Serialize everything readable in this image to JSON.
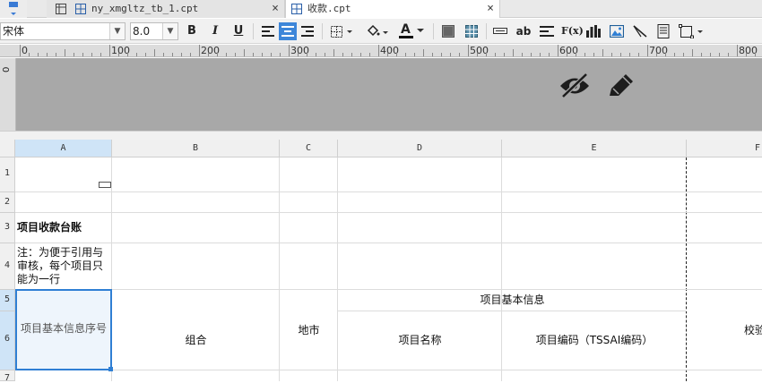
{
  "tabs": [
    {
      "label": "ny_xmgltz_tb_1.cpt",
      "close": "×",
      "active": false
    },
    {
      "label": "收款.cpt",
      "close": "×",
      "active": true
    }
  ],
  "toolbar": {
    "font_family": "宋体",
    "font_size": "8.0",
    "bold": "B",
    "italic": "I",
    "underline": "U",
    "text_color_glyph": "A",
    "abc_label": "ab",
    "formula_label": "F(x)"
  },
  "ruler": {
    "ticks": [
      "0",
      "100",
      "200",
      "300",
      "400",
      "500",
      "600",
      "700",
      "800"
    ],
    "vertical": "0"
  },
  "columns": [
    "A",
    "B",
    "C",
    "D",
    "E",
    "F"
  ],
  "rows": [
    "1",
    "2",
    "3",
    "4",
    "5",
    "6",
    "7"
  ],
  "cells": {
    "a3": "项目收款台账",
    "a4": "注：为便于引用与审核，每个项目只能为一行",
    "a5": "项目基本信息序号",
    "b6": "组合",
    "c5": "地市",
    "d5": "项目基本信息",
    "d6": "项目名称",
    "e6": "项目编码（TSSAI编码）",
    "f6": "校验"
  },
  "colors": {
    "selection_border": "#2f7fd4",
    "selection_fill": "#eef5fc",
    "active_button": "#3d86d9",
    "canvas_gray": "#a8a8a8"
  }
}
